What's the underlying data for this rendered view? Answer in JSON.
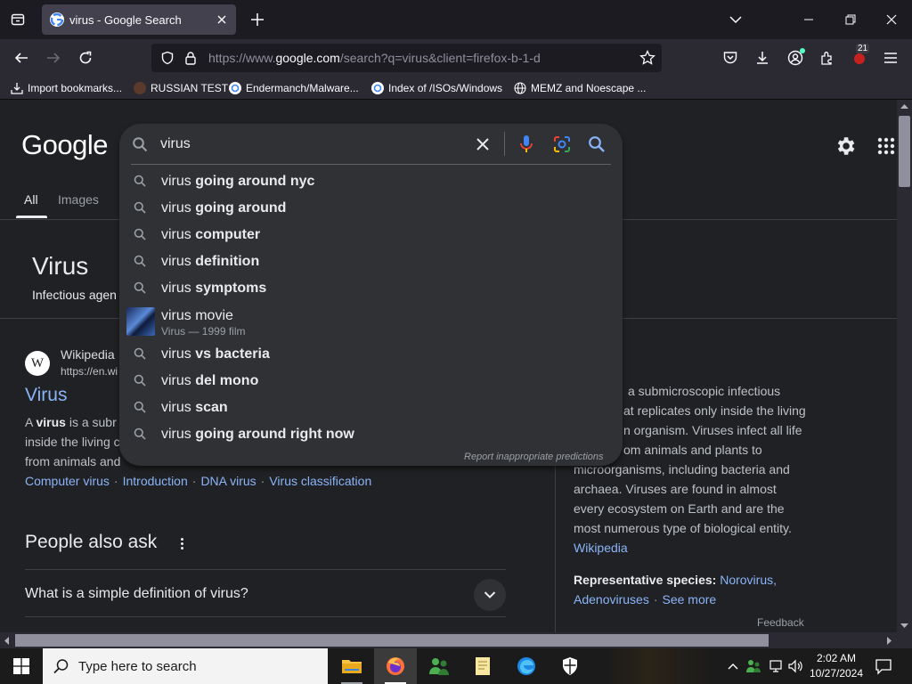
{
  "browser": {
    "tab": {
      "title": "virus - Google Search"
    },
    "url": {
      "prefix": "https://www.",
      "domain": "google.com",
      "suffix": "/search?q=virus&client=firefox-b-1-d"
    },
    "extension_badge": "21",
    "bookmarks": [
      {
        "label": "Import bookmarks..."
      },
      {
        "label": "RUSSIAN TEST"
      },
      {
        "label": "Endermanch/Malware..."
      },
      {
        "label": "Index of /ISOs/Windows"
      },
      {
        "label": "MEMZ and Noescape ..."
      }
    ]
  },
  "google": {
    "logo": "Google",
    "nav_tabs": {
      "all": "All",
      "images": "Images"
    },
    "search": {
      "query": "virus",
      "suggestions": [
        {
          "prefix": "virus",
          "bold": " going around nyc"
        },
        {
          "prefix": "virus",
          "bold": " going around"
        },
        {
          "prefix": "virus",
          "bold": " computer"
        },
        {
          "prefix": "virus",
          "bold": " definition"
        },
        {
          "prefix": "virus",
          "bold": " symptoms"
        }
      ],
      "movie_suggestion": {
        "title": "virus movie",
        "subtitle": "Virus — 1999 film"
      },
      "suggestions_after": [
        {
          "prefix": "virus",
          "bold": " vs bacteria"
        },
        {
          "prefix": "virus",
          "bold": " del mono"
        },
        {
          "prefix": "virus",
          "bold": " scan"
        },
        {
          "prefix": "virus",
          "bold": " going around right now"
        }
      ],
      "report": "Report inappropriate predictions"
    },
    "knowledge_header": {
      "title": "Virus",
      "subtitle": "Infectious agen"
    },
    "result": {
      "source_name": "Wikipedia",
      "source_url": "https://en.wi",
      "favicon_letter": "W",
      "title": "Virus",
      "snippet_line1_pre": "A ",
      "snippet_line1_bold": "virus",
      "snippet_line1_post": " is a subr",
      "snippet_line2": "inside the living c",
      "snippet_line3": "from animals and",
      "sitelinks": [
        "Computer virus",
        "Introduction",
        "DNA virus",
        "Virus classification"
      ]
    },
    "people_also_ask": {
      "title": "People also ask",
      "questions": [
        "What is a simple definition of virus?"
      ]
    },
    "knowledge_panel": {
      "lines": [
        "a submicroscopic infectious",
        "at replicates only inside the living",
        "n organism. Viruses infect all life",
        "om animals and plants to",
        "microorganisms, including bacteria and",
        "archaea. Viruses are found in almost",
        "every ecosystem on Earth and are the",
        "most numerous type of biological entity."
      ],
      "source_link": "Wikipedia",
      "species_label": "Representative species:",
      "species": [
        "Norovirus,",
        "Adenoviruses"
      ],
      "see_more": "See more",
      "feedback": "Feedback"
    }
  },
  "taskbar": {
    "search_placeholder": "Type here to search",
    "time": "2:02 AM",
    "date": "10/27/2024"
  }
}
